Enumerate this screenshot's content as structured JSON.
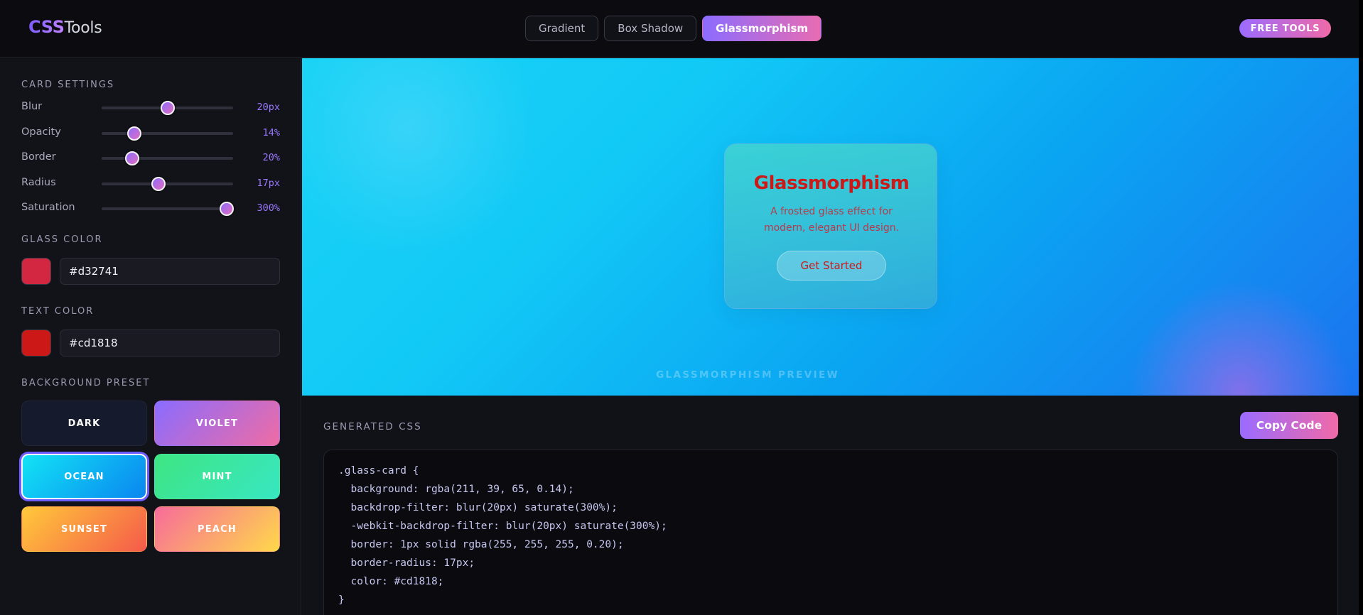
{
  "header": {
    "logo_bold": "CSS",
    "logo_rest": "Tools",
    "tabs": [
      {
        "label": "Gradient",
        "active": false
      },
      {
        "label": "Box Shadow",
        "active": false
      },
      {
        "label": "Glassmorphism",
        "active": true
      }
    ],
    "badge": "FREE TOOLS"
  },
  "sidebar": {
    "card_settings_title": "CARD SETTINGS",
    "sliders": [
      {
        "label": "Blur",
        "value_text": "20px",
        "fraction": 0.5
      },
      {
        "label": "Opacity",
        "value_text": "14%",
        "fraction": 0.25
      },
      {
        "label": "Border",
        "value_text": "20%",
        "fraction": 0.23
      },
      {
        "label": "Radius",
        "value_text": "17px",
        "fraction": 0.43
      },
      {
        "label": "Saturation",
        "value_text": "300%",
        "fraction": 0.95
      }
    ],
    "glass_color_title": "GLASS COLOR",
    "glass_color": "#d32741",
    "text_color_title": "TEXT COLOR",
    "text_color": "#cd1818",
    "bg_preset_title": "BACKGROUND PRESET",
    "presets": [
      {
        "label": "DARK",
        "selected": false
      },
      {
        "label": "VIOLET",
        "selected": false
      },
      {
        "label": "OCEAN",
        "selected": true
      },
      {
        "label": "MINT",
        "selected": false
      },
      {
        "label": "SUNSET",
        "selected": false
      },
      {
        "label": "PEACH",
        "selected": false
      }
    ]
  },
  "preview": {
    "card_title": "Glassmorphism",
    "card_text_line1": "A frosted glass effect for",
    "card_text_line2": "modern, elegant UI design.",
    "card_button": "Get Started",
    "caption": "GLASSMORPHISM PREVIEW"
  },
  "code_panel": {
    "title": "GENERATED CSS",
    "copy_button": "Copy Code",
    "lines": [
      ".glass-card {",
      "  background: rgba(211, 39, 65, 0.14);",
      "  backdrop-filter: blur(20px) saturate(300%);",
      "  -webkit-backdrop-filter: blur(20px) saturate(300%);",
      "  border: 1px solid rgba(255, 255, 255, 0.20);",
      "  border-radius: 17px;",
      "  color: #cd1818;",
      "}"
    ]
  },
  "colors": {
    "accent_start": "#8b6cff",
    "accent_end": "#e86cb2",
    "slider_value": "#9a78ff"
  }
}
